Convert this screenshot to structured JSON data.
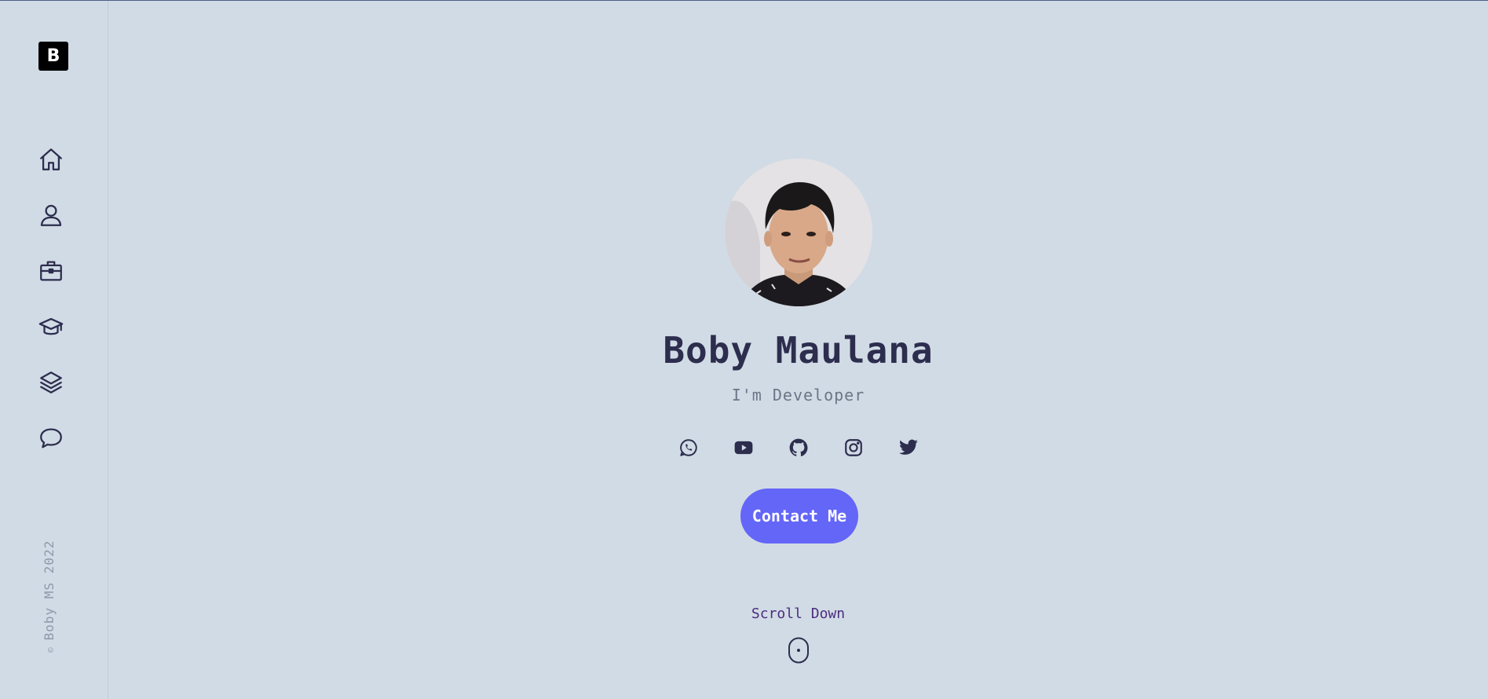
{
  "sidebar": {
    "logo_letter": "B",
    "nav": [
      {
        "icon": "home-icon"
      },
      {
        "icon": "user-icon"
      },
      {
        "icon": "briefcase-icon"
      },
      {
        "icon": "graduation-cap-icon"
      },
      {
        "icon": "layers-icon"
      },
      {
        "icon": "chat-icon"
      }
    ],
    "copyright_symbol": "©",
    "copyright_text": "Boby MS 2022"
  },
  "hero": {
    "name": "Boby Maulana",
    "role": "I'm Developer",
    "socials": [
      "whatsapp-icon",
      "youtube-icon",
      "github-icon",
      "instagram-icon",
      "twitter-icon"
    ],
    "contact_label": "Contact Me",
    "scroll_label": "Scroll Down"
  },
  "colors": {
    "background": "#d1dbe5",
    "text": "#2d2d4e",
    "accent": "#6366f6"
  }
}
